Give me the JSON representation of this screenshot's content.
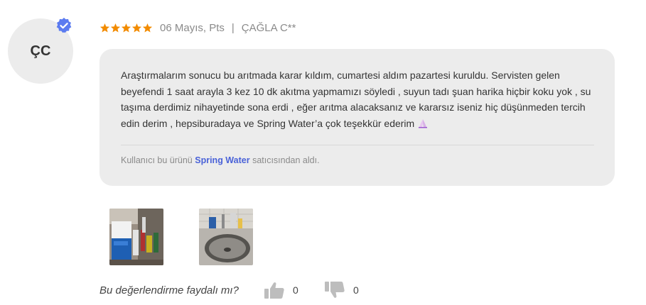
{
  "reviewer": {
    "initials": "ÇC",
    "verified_icon": "verified-badge-icon",
    "badge_color": "#5b7bf0"
  },
  "meta": {
    "rating": 5,
    "star_color": "#f28b00",
    "date": "06 Mayıs, Pts",
    "separator": "|",
    "name": "ÇAĞLA C**"
  },
  "review": {
    "text": "Araştırmalarım sonucu bu arıtmada karar kıldım, cumartesi aldım pazartesi kuruldu. Servisten gelen beyefendi 1 saat arayla 3 kez 10 dk akıtma yapmamızı söyledi , suyun tadı şuan harika hiçbir koku yok , su taşıma derdimiz nihayetinde sona erdi , eğer arıtma alacaksanız ve kararsız iseniz hiç düşünmeden tercih edin derim , hepsiburadaya ve Spring Water’a çok teşekkür ederim",
    "emoji": "folded-hands-icon",
    "seller_prefix": "Kullanıcı bu ürünü",
    "seller_name": "Spring Water",
    "seller_suffix": "satıcısından aldı.",
    "seller_color": "#4a62d8"
  },
  "photos": [
    {
      "name": "photo-water-purifier-under-sink"
    },
    {
      "name": "photo-sink-with-faucet"
    }
  ],
  "helpful": {
    "question": "Bu değerlendirme faydalı mı?",
    "thumbs_up_icon": "thumbs-up-icon",
    "up_count": "0",
    "thumbs_down_icon": "thumbs-down-icon",
    "down_count": "0"
  }
}
